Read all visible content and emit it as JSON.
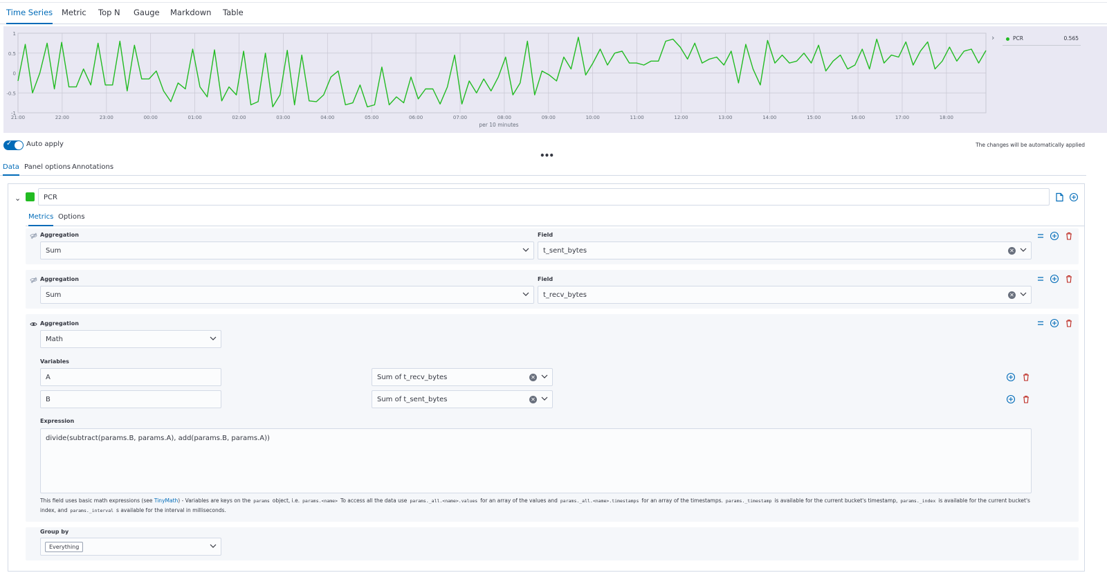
{
  "vis_tabs": [
    "Time Series",
    "Metric",
    "Top N",
    "Gauge",
    "Markdown",
    "Table"
  ],
  "chart": {
    "legend": {
      "name": "PCR",
      "value": "0.565"
    },
    "y_ticks": [
      "1",
      "0.5",
      "0",
      "-0.5",
      "-1"
    ],
    "x_ticks": [
      "21:00",
      "22:00",
      "23:00",
      "00:00",
      "01:00",
      "02:00",
      "03:00",
      "04:00",
      "05:00",
      "06:00",
      "07:00",
      "08:00",
      "09:00",
      "10:00",
      "11:00",
      "12:00",
      "13:00",
      "14:00",
      "15:00",
      "16:00",
      "17:00",
      "18:00"
    ],
    "x_label": "per 10 minutes",
    "line_color": "#22bb22",
    "background": "#e9e8f3"
  },
  "chart_data": {
    "type": "line",
    "ylim": [
      -1,
      1
    ],
    "x_start": "21:00",
    "x_interval": "10 minutes",
    "series": [
      {
        "name": "PCR",
        "values": [
          -0.2,
          0.72,
          -0.5,
          0.0,
          0.75,
          -0.4,
          0.77,
          -0.35,
          -0.35,
          0.1,
          -0.3,
          0.75,
          -0.3,
          -0.3,
          0.8,
          -0.45,
          0.7,
          -0.15,
          -0.15,
          0.05,
          -0.45,
          -0.72,
          -0.25,
          -0.4,
          0.6,
          -0.35,
          -0.6,
          0.58,
          -0.7,
          -0.35,
          -0.55,
          0.55,
          -0.8,
          -0.72,
          0.5,
          -0.85,
          -0.55,
          0.57,
          -0.8,
          0.45,
          -0.7,
          -0.72,
          -0.55,
          -0.1,
          0.05,
          -0.8,
          -0.75,
          -0.3,
          -0.85,
          -0.8,
          0.15,
          -0.8,
          -0.6,
          -0.75,
          -0.1,
          -0.65,
          -0.4,
          -0.4,
          -0.78,
          -0.35,
          0.45,
          -0.78,
          -0.2,
          -0.5,
          -0.15,
          -0.45,
          -0.1,
          0.4,
          -0.55,
          -0.25,
          0.8,
          -0.55,
          0.05,
          -0.05,
          -0.2,
          0.4,
          0.1,
          0.9,
          -0.05,
          0.25,
          0.6,
          0.2,
          0.5,
          0.55,
          0.25,
          0.25,
          0.2,
          0.3,
          0.3,
          0.8,
          0.85,
          0.65,
          0.35,
          0.75,
          0.25,
          0.35,
          0.4,
          0.2,
          0.55,
          -0.25,
          0.72,
          0.1,
          -0.3,
          0.82,
          0.25,
          0.45,
          0.25,
          0.3,
          0.5,
          0.25,
          0.7,
          0.05,
          0.3,
          0.45,
          0.1,
          0.2,
          0.6,
          0.1,
          0.85,
          0.25,
          0.45,
          0.4,
          0.78,
          0.2,
          0.55,
          0.78,
          0.1,
          0.3,
          0.65,
          0.3,
          0.55,
          0.6,
          0.25,
          0.565
        ]
      }
    ]
  },
  "auto_apply": {
    "label": "Auto apply",
    "note": "The changes will be automatically applied",
    "enabled": true
  },
  "editor_tabs": [
    "Data",
    "Panel options",
    "Annotations"
  ],
  "series": {
    "label": "PCR",
    "color": "#22bb22",
    "sub_tabs": [
      "Metrics",
      "Options"
    ],
    "metrics": [
      {
        "agg_label": "Aggregation",
        "aggregation": "Sum",
        "field_label": "Field",
        "field": "t_sent_bytes"
      },
      {
        "agg_label": "Aggregation",
        "aggregation": "Sum",
        "field_label": "Field",
        "field": "t_recv_bytes"
      }
    ],
    "math": {
      "agg_label": "Aggregation",
      "aggregation": "Math",
      "variables_label": "Variables",
      "variables": [
        {
          "name": "A",
          "metric": "Sum of t_recv_bytes"
        },
        {
          "name": "B",
          "metric": "Sum of t_sent_bytes"
        }
      ],
      "expression_label": "Expression",
      "expression": "divide(subtract(params.B, params.A), add(params.B, params.A))",
      "help": {
        "t1": "This field uses basic math expressions (see ",
        "link": "TinyMath",
        "t2": ") - Variables are keys on the",
        "c1": "params",
        "t3": "object, i.e.",
        "c2": "params.<name>",
        "t4": "To access all the data use",
        "c3": "params._all.<name>.values",
        "t5": "for an array of the values and",
        "c4": "params._all.<name>.timestamps",
        "t6": "for an array of the timestamps.",
        "c5": "params._timestamp",
        "t7": "is available for the current bucket's timestamp,",
        "c6": "params._index",
        "t8": "is available for the current bucket's index, and",
        "c7": "params._interval",
        "t9": "s available for the interval in milliseconds."
      }
    },
    "group_by": {
      "label": "Group by",
      "value": "Everything"
    }
  }
}
